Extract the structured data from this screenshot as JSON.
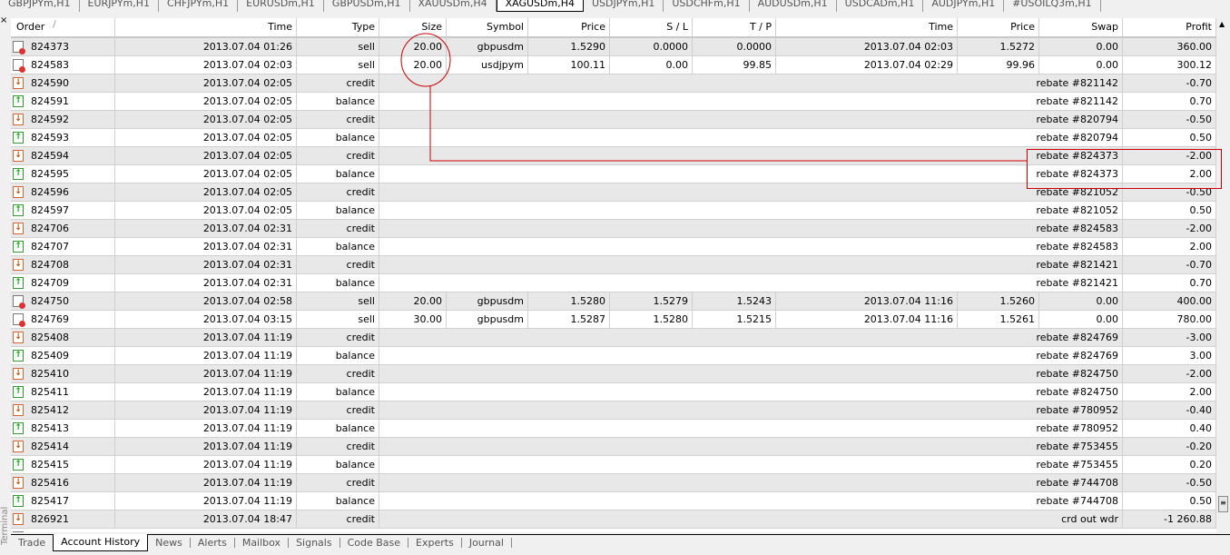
{
  "chart_tabs": [
    "GBPJPYm,H1",
    "EURJPYm,H1",
    "CHFJPYm,H1",
    "EURUSDm,H1",
    "GBPUSDm,H1",
    "XAUUSDm,H4",
    "XAGUSDm,H4",
    "USDJPYm,H1",
    "USDCHFm,H1",
    "AUDUSDm,H1",
    "USDCADm,H1",
    "AUDJPYm,H1",
    "#USOILQ3m,H1"
  ],
  "active_chart_tab": "XAGUSDm,H4",
  "side_label": "Terminal",
  "columns": [
    "Order",
    "Time",
    "Type",
    "Size",
    "Symbol",
    "Price",
    "S / L",
    "T / P",
    "Time",
    "Price",
    "Swap",
    "Profit"
  ],
  "sort_indicator": "/",
  "rows": [
    {
      "icon": "doc",
      "order": "824373",
      "time": "2013.07.04 01:26",
      "type": "sell",
      "size": "20.00",
      "symbol": "gbpusdm",
      "price": "1.5290",
      "sl": "0.0000",
      "tp": "0.0000",
      "ctime": "2013.07.04 02:03",
      "cprice": "1.5272",
      "swap": "0.00",
      "profit": "360.00"
    },
    {
      "icon": "doc",
      "order": "824583",
      "time": "2013.07.04 02:03",
      "type": "sell",
      "size": "20.00",
      "symbol": "usdjpym",
      "price": "100.11",
      "sl": "0.00",
      "tp": "99.85",
      "ctime": "2013.07.04 02:29",
      "cprice": "99.96",
      "swap": "0.00",
      "profit": "300.12"
    },
    {
      "icon": "down",
      "order": "824590",
      "time": "2013.07.04 02:05",
      "type": "credit",
      "comment": "rebate #821142",
      "profit": "-0.70"
    },
    {
      "icon": "up",
      "order": "824591",
      "time": "2013.07.04 02:05",
      "type": "balance",
      "comment": "rebate #821142",
      "profit": "0.70"
    },
    {
      "icon": "down",
      "order": "824592",
      "time": "2013.07.04 02:05",
      "type": "credit",
      "comment": "rebate #820794",
      "profit": "-0.50"
    },
    {
      "icon": "up",
      "order": "824593",
      "time": "2013.07.04 02:05",
      "type": "balance",
      "comment": "rebate #820794",
      "profit": "0.50"
    },
    {
      "icon": "down",
      "order": "824594",
      "time": "2013.07.04 02:05",
      "type": "credit",
      "comment": "rebate #824373",
      "profit": "-2.00"
    },
    {
      "icon": "up",
      "order": "824595",
      "time": "2013.07.04 02:05",
      "type": "balance",
      "comment": "rebate #824373",
      "profit": "2.00"
    },
    {
      "icon": "down",
      "order": "824596",
      "time": "2013.07.04 02:05",
      "type": "credit",
      "comment": "rebate #821052",
      "profit": "-0.50"
    },
    {
      "icon": "up",
      "order": "824597",
      "time": "2013.07.04 02:05",
      "type": "balance",
      "comment": "rebate #821052",
      "profit": "0.50"
    },
    {
      "icon": "down",
      "order": "824706",
      "time": "2013.07.04 02:31",
      "type": "credit",
      "comment": "rebate #824583",
      "profit": "-2.00"
    },
    {
      "icon": "up",
      "order": "824707",
      "time": "2013.07.04 02:31",
      "type": "balance",
      "comment": "rebate #824583",
      "profit": "2.00"
    },
    {
      "icon": "down",
      "order": "824708",
      "time": "2013.07.04 02:31",
      "type": "credit",
      "comment": "rebate #821421",
      "profit": "-0.70"
    },
    {
      "icon": "up",
      "order": "824709",
      "time": "2013.07.04 02:31",
      "type": "balance",
      "comment": "rebate #821421",
      "profit": "0.70"
    },
    {
      "icon": "doc",
      "order": "824750",
      "time": "2013.07.04 02:58",
      "type": "sell",
      "size": "20.00",
      "symbol": "gbpusdm",
      "price": "1.5280",
      "sl": "1.5279",
      "tp": "1.5243",
      "ctime": "2013.07.04 11:16",
      "cprice": "1.5260",
      "swap": "0.00",
      "profit": "400.00"
    },
    {
      "icon": "doc",
      "order": "824769",
      "time": "2013.07.04 03:15",
      "type": "sell",
      "size": "30.00",
      "symbol": "gbpusdm",
      "price": "1.5287",
      "sl": "1.5280",
      "tp": "1.5215",
      "ctime": "2013.07.04 11:16",
      "cprice": "1.5261",
      "swap": "0.00",
      "profit": "780.00"
    },
    {
      "icon": "down",
      "order": "825408",
      "time": "2013.07.04 11:19",
      "type": "credit",
      "comment": "rebate #824769",
      "profit": "-3.00"
    },
    {
      "icon": "up",
      "order": "825409",
      "time": "2013.07.04 11:19",
      "type": "balance",
      "comment": "rebate #824769",
      "profit": "3.00"
    },
    {
      "icon": "down",
      "order": "825410",
      "time": "2013.07.04 11:19",
      "type": "credit",
      "comment": "rebate #824750",
      "profit": "-2.00"
    },
    {
      "icon": "up",
      "order": "825411",
      "time": "2013.07.04 11:19",
      "type": "balance",
      "comment": "rebate #824750",
      "profit": "2.00"
    },
    {
      "icon": "down",
      "order": "825412",
      "time": "2013.07.04 11:19",
      "type": "credit",
      "comment": "rebate #780952",
      "profit": "-0.40"
    },
    {
      "icon": "up",
      "order": "825413",
      "time": "2013.07.04 11:19",
      "type": "balance",
      "comment": "rebate #780952",
      "profit": "0.40"
    },
    {
      "icon": "down",
      "order": "825414",
      "time": "2013.07.04 11:19",
      "type": "credit",
      "comment": "rebate #753455",
      "profit": "-0.20"
    },
    {
      "icon": "up",
      "order": "825415",
      "time": "2013.07.04 11:19",
      "type": "balance",
      "comment": "rebate #753455",
      "profit": "0.20"
    },
    {
      "icon": "down",
      "order": "825416",
      "time": "2013.07.04 11:19",
      "type": "credit",
      "comment": "rebate #744708",
      "profit": "-0.50"
    },
    {
      "icon": "up",
      "order": "825417",
      "time": "2013.07.04 11:19",
      "type": "balance",
      "comment": "rebate #744708",
      "profit": "0.50"
    },
    {
      "icon": "down",
      "order": "826921",
      "time": "2013.07.04 18:47",
      "type": "credit",
      "comment": "crd out wdr",
      "profit": "-1 260.88"
    }
  ],
  "bottom_tabs": [
    "Trade",
    "Account History",
    "News",
    "Alerts",
    "Mailbox",
    "Signals",
    "Code Base",
    "Experts",
    "Journal"
  ],
  "active_bottom_tab": "Account History",
  "annotation_color": "#cc0000"
}
